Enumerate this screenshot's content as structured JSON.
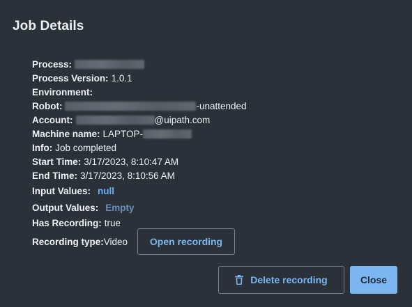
{
  "dialog": {
    "title": "Job Details"
  },
  "details": {
    "process_label": "Process:",
    "process_version_label": "Process Version:",
    "process_version_value": "1.0.1",
    "environment_label": "Environment:",
    "robot_label": "Robot:",
    "robot_suffix": "-unattended",
    "account_label": "Account:",
    "account_suffix": "@uipath.com",
    "machine_label": "Machine name:",
    "machine_prefix": "LAPTOP-",
    "info_label": "Info:",
    "info_value": "Job completed",
    "start_label": "Start Time:",
    "start_value": "3/17/2023, 8:10:47 AM",
    "end_label": "End Time:",
    "end_value": "3/17/2023, 8:10:56 AM",
    "input_label": "Input Values:",
    "input_value": "null",
    "output_label": "Output Values:",
    "output_value": "Empty",
    "has_recording_label": "Has Recording:",
    "has_recording_value": "true",
    "recording_type_label": "Recording type:",
    "recording_type_value": "Video"
  },
  "buttons": {
    "open_recording": "Open recording",
    "delete_recording": "Delete recording",
    "close": "Close"
  },
  "icons": {
    "delete": "trash-icon"
  },
  "colors": {
    "background": "#2b3138",
    "link": "#6eaef0",
    "primary_button": "#7cb6f0"
  }
}
